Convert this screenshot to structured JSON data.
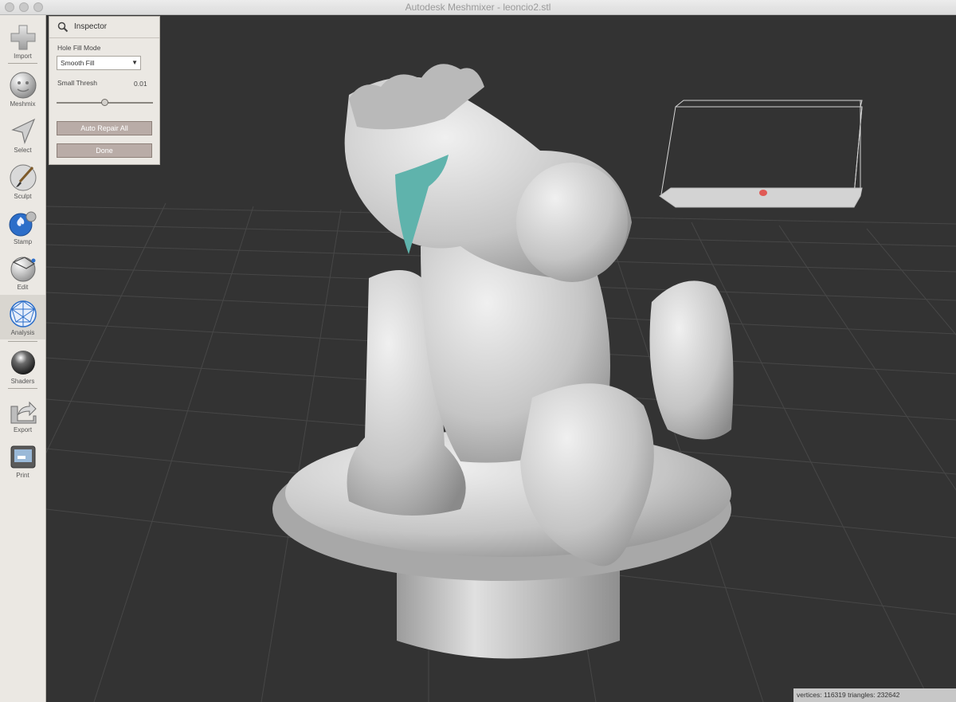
{
  "window": {
    "title": "Autodesk Meshmixer - leoncio2.stl"
  },
  "toolbar": {
    "items": [
      {
        "label": "Import",
        "icon": "plus-icon"
      },
      {
        "label": "Meshmix",
        "icon": "meshmix-face-icon"
      },
      {
        "label": "Select",
        "icon": "arrow-cursor-icon"
      },
      {
        "label": "Sculpt",
        "icon": "brush-icon"
      },
      {
        "label": "Stamp",
        "icon": "stamp-icon"
      },
      {
        "label": "Edit",
        "icon": "edit-icon"
      },
      {
        "label": "Analysis",
        "icon": "analysis-mesh-icon",
        "active": true
      },
      {
        "label": "Shaders",
        "icon": "shader-sphere-icon"
      },
      {
        "label": "Export",
        "icon": "export-icon"
      },
      {
        "label": "Print",
        "icon": "printer-icon"
      }
    ]
  },
  "inspector": {
    "title": "Inspector",
    "icon": "magnifier-icon",
    "hole_fill_mode_label": "Hole Fill Mode",
    "hole_fill_mode_value": "Smooth Fill",
    "small_thresh_label": "Small Thresh",
    "small_thresh_value": "0.01",
    "small_thresh_slider_fraction": 0.5,
    "auto_repair_label": "Auto Repair All",
    "done_label": "Done"
  },
  "status": {
    "text": "vertices: 116319 triangles: 232642"
  },
  "colors": {
    "accent_active_tool": "#d9d6d0",
    "button_fill": "#b9aca7",
    "viewport_bg": "#333333",
    "mesh": "#c9c9c9",
    "hole_highlight": "#5fb3ac",
    "marker": "#e05a55"
  }
}
